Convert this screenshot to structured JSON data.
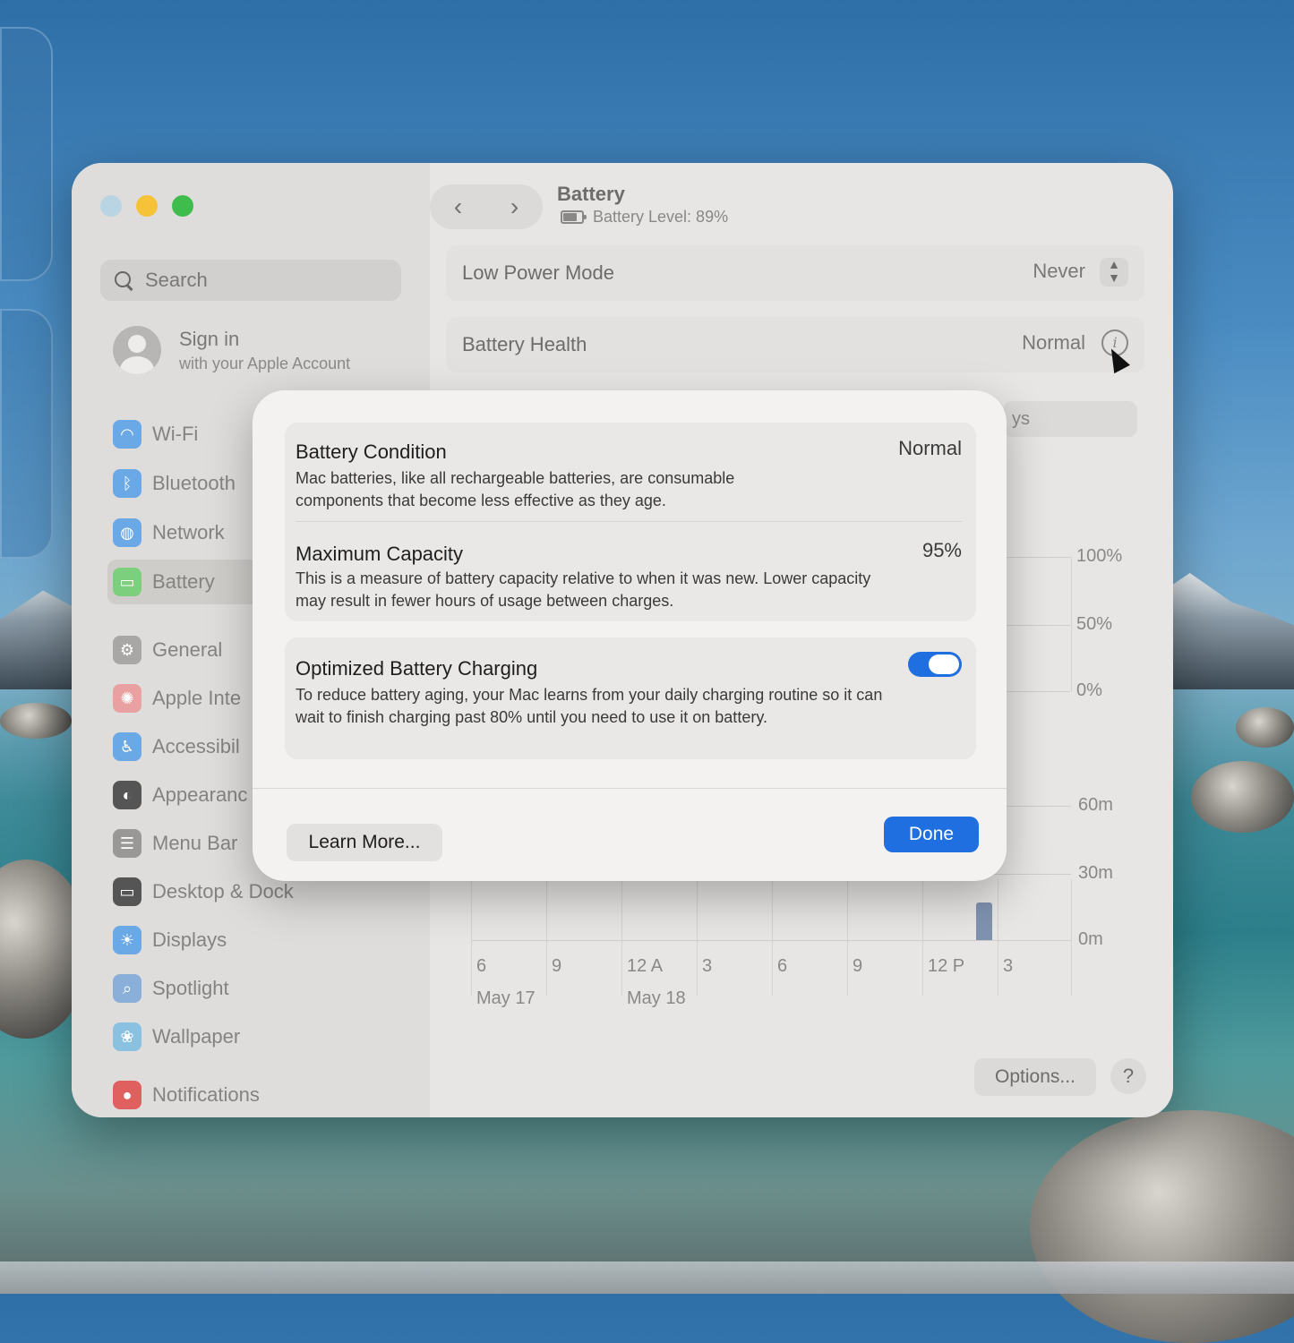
{
  "window": {
    "title": "Battery",
    "subtitle": "Battery Level: 89%",
    "nav_back": "‹",
    "nav_forward": "›"
  },
  "sidebar": {
    "search_placeholder": "Search",
    "account_title": "Sign in",
    "account_subtitle": "with your Apple Account",
    "items": [
      {
        "label": "Wi-Fi",
        "icon": "wifi-icon",
        "color": "#6aa8e6",
        "glyph": "◠"
      },
      {
        "label": "Bluetooth",
        "icon": "bluetooth-icon",
        "color": "#6aa8e6",
        "glyph": "ᛒ"
      },
      {
        "label": "Network",
        "icon": "globe-icon",
        "color": "#6aa8e6",
        "glyph": "◍"
      },
      {
        "label": "Battery",
        "icon": "battery-icon",
        "color": "#7ccf7c",
        "glyph": "▭"
      },
      {
        "label": "General",
        "icon": "gear-icon",
        "color": "#a9a7a5",
        "glyph": "⚙"
      },
      {
        "label": "Apple Inte",
        "icon": "apple-intelligence-icon",
        "color": "#e9a0a0",
        "glyph": "✺"
      },
      {
        "label": "Accessibil",
        "icon": "accessibility-icon",
        "color": "#6aa8e6",
        "glyph": "♿"
      },
      {
        "label": "Appearanc",
        "icon": "appearance-icon",
        "color": "#555555",
        "glyph": "◐"
      },
      {
        "label": "Menu Bar",
        "icon": "menu-bar-icon",
        "color": "#9a9896",
        "glyph": "☰"
      },
      {
        "label": "Desktop & Dock",
        "icon": "desktop-dock-icon",
        "color": "#555555",
        "glyph": "▭"
      },
      {
        "label": "Displays",
        "icon": "displays-icon",
        "color": "#6aa8e6",
        "glyph": "☀"
      },
      {
        "label": "Spotlight",
        "icon": "spotlight-icon",
        "color": "#8ab0da",
        "glyph": "⌕"
      },
      {
        "label": "Wallpaper",
        "icon": "wallpaper-icon",
        "color": "#8ac0e0",
        "glyph": "❀"
      },
      {
        "label": "Notifications",
        "icon": "notifications-icon",
        "color": "#e06060",
        "glyph": "●"
      }
    ]
  },
  "settings": {
    "low_power_label": "Low Power Mode",
    "low_power_value": "Never",
    "health_label": "Battery Health",
    "health_value": "Normal",
    "behind_pill": "ys"
  },
  "chart": {
    "level_ticks": [
      "100%",
      "50%",
      "0%"
    ],
    "usage_ticks": [
      "60m",
      "30m",
      "0m"
    ],
    "x_ticks": [
      "6",
      "9",
      "12 A",
      "3",
      "6",
      "9",
      "12 P",
      "3"
    ],
    "dates": [
      "May 17",
      "May 18"
    ]
  },
  "dialog": {
    "condition_title": "Battery Condition",
    "condition_value": "Normal",
    "condition_desc": "Mac batteries, like all rechargeable batteries, are consumable components that become less effective as they age.",
    "capacity_title": "Maximum Capacity",
    "capacity_value": "95%",
    "capacity_desc": "This is a measure of battery capacity relative to when it was new. Lower capacity may result in fewer hours of usage between charges.",
    "optimized_title": "Optimized Battery Charging",
    "optimized_desc": "To reduce battery aging, your Mac learns from your daily charging routine so it can wait to finish charging past 80% until you need to use it on battery.",
    "optimized_enabled": true,
    "learn_more": "Learn More...",
    "done": "Done"
  },
  "footer": {
    "options": "Options...",
    "help": "?"
  }
}
